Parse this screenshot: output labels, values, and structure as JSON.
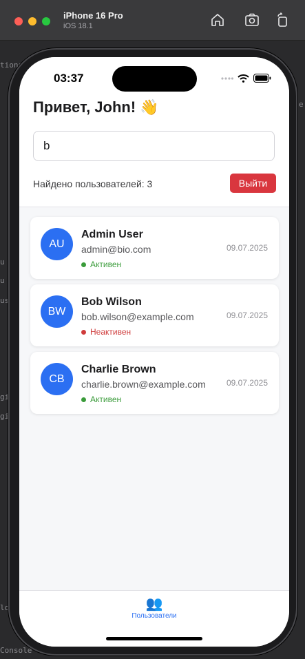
{
  "simulator": {
    "device_name": "iPhone 16 Pro",
    "os_version": "iOS 18.1"
  },
  "background_fragments": [
    "tions",
    "Console",
    "lo",
    "gi",
    "gir",
    "u",
    "u",
    "us",
    "e"
  ],
  "status_bar": {
    "time": "03:37"
  },
  "header": {
    "greeting": "Привет, John! 👋",
    "search_value": "b",
    "found_count": "Найдено пользователей: 3",
    "logout_label": "Выйти"
  },
  "users": [
    {
      "initials": "AU",
      "name": "Admin User",
      "email": "admin@bio.com",
      "status": "Активен",
      "status_color": "#3a9b3a",
      "date": "09.07.2025"
    },
    {
      "initials": "BW",
      "name": "Bob Wilson",
      "email": "bob.wilson@example.com",
      "status": "Неактивен",
      "status_color": "#cf3b3b",
      "date": "09.07.2025"
    },
    {
      "initials": "CB",
      "name": "Charlie Brown",
      "email": "charlie.brown@example.com",
      "status": "Активен",
      "status_color": "#3a9b3a",
      "date": "09.07.2025"
    }
  ],
  "tabbar": {
    "tabs": [
      {
        "label": "Пользователи",
        "icon": "users-icon"
      }
    ]
  },
  "colors": {
    "accent": "#2b6ff2",
    "danger": "#d9363e",
    "active": "#3a9b3a",
    "inactive": "#cf3b3b"
  }
}
